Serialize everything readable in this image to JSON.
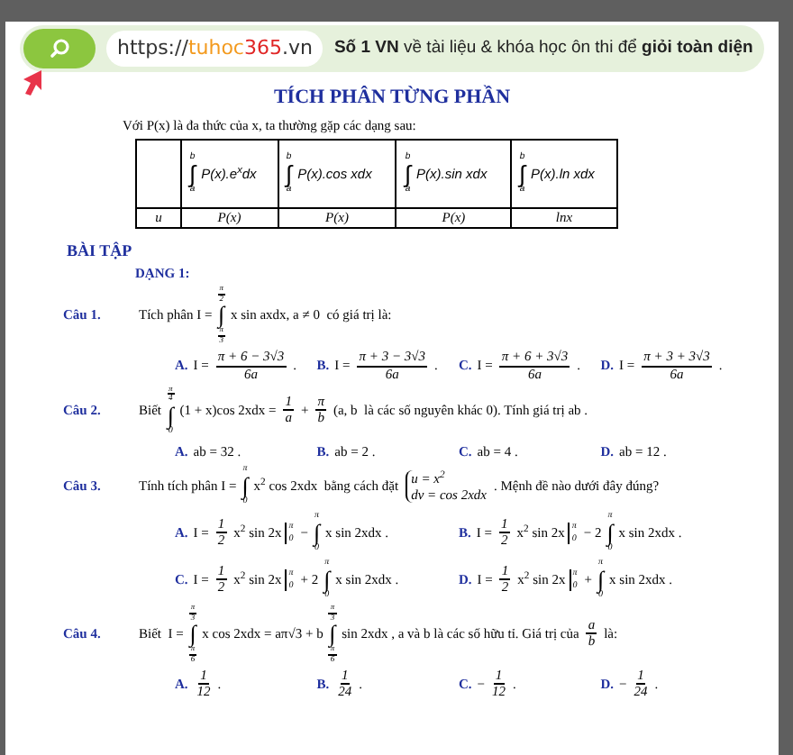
{
  "banner": {
    "url_parts": [
      {
        "text": "https://",
        "color": "#333333"
      },
      {
        "text": "tuhoc",
        "color": "#f39a1e"
      },
      {
        "text": "365",
        "color": "#e02626"
      },
      {
        "text": ".vn",
        "color": "#333333"
      }
    ],
    "tagline": "**Số 1 VN** về tài liệu & khóa học ôn thi để **giỏi toàn diện**"
  },
  "title": "TÍCH PHÂN TỪNG PHẦN",
  "intro": "Với P(x) là đa thức của x, ta thường gặp các dạng sau:",
  "table": {
    "header": [
      [
        {
          "kind": "int",
          "sign": "∫",
          "upper": "b",
          "lower": "a"
        },
        {
          "kind": "text",
          "text": "P(x).e$^{x}$dx"
        }
      ],
      [
        {
          "kind": "int",
          "sign": "∫",
          "upper": "b",
          "lower": "a"
        },
        {
          "kind": "text",
          "text": "P(x).cos xdx"
        }
      ],
      [
        {
          "kind": "int",
          "sign": "∫",
          "upper": "b",
          "lower": "a"
        },
        {
          "kind": "text",
          "text": "P(x).sin xdx"
        }
      ],
      [
        {
          "kind": "int",
          "sign": "∫",
          "upper": "b",
          "lower": "a"
        },
        {
          "kind": "text",
          "text": "P(x).ln xdx"
        }
      ]
    ],
    "row": [
      "u",
      "P(x)",
      "P(x)",
      "P(x)",
      "lnx"
    ]
  },
  "section": "BÀI TẬP",
  "subsection": "DẠNG 1:",
  "questions": [
    {
      "label": "Câu 1.",
      "stem": [
        {
          "kind": "text",
          "text": "Tích phân I ="
        },
        {
          "kind": "int",
          "sign": "∫",
          "upper": {
            "num": "π",
            "den": "2"
          },
          "lower": {
            "num": "π",
            "den": "3"
          }
        },
        {
          "kind": "text",
          "text": "x sin axdx, a ≠ 0  có giá trị là:"
        }
      ],
      "option_rows": [
        [
          {
            "label": "A.",
            "parts": [
              {
                "kind": "text",
                "text": "I ="
              },
              {
                "kind": "frac",
                "num": "π + 6 − 3√3",
                "den": "6a"
              },
              {
                "kind": "text",
                "text": "."
              }
            ]
          },
          {
            "label": "B.",
            "parts": [
              {
                "kind": "text",
                "text": "I ="
              },
              {
                "kind": "frac",
                "num": "π + 3 − 3√3",
                "den": "6a"
              },
              {
                "kind": "text",
                "text": "."
              }
            ]
          },
          {
            "label": "C.",
            "parts": [
              {
                "kind": "text",
                "text": "I ="
              },
              {
                "kind": "frac",
                "num": "π + 6 + 3√3",
                "den": "6a"
              },
              {
                "kind": "text",
                "text": "."
              }
            ]
          },
          {
            "label": "D.",
            "parts": [
              {
                "kind": "text",
                "text": "I ="
              },
              {
                "kind": "frac",
                "num": "π + 3 + 3√3",
                "den": "6a"
              },
              {
                "kind": "text",
                "text": "."
              }
            ]
          }
        ]
      ]
    },
    {
      "label": "Câu 2.",
      "stem": [
        {
          "kind": "text",
          "text": "Biết"
        },
        {
          "kind": "int",
          "sign": "∫",
          "upper": {
            "num": "π",
            "den": "4"
          },
          "lower": "0"
        },
        {
          "kind": "text",
          "text": "(1 + x)cos 2xdx ="
        },
        {
          "kind": "frac",
          "num": "1",
          "den": "a"
        },
        {
          "kind": "text",
          "text": "+"
        },
        {
          "kind": "frac",
          "num": "π",
          "den": "b"
        },
        {
          "kind": "text",
          "text": "(a, b  là các số nguyên khác 0). Tính giá trị ab ."
        }
      ],
      "option_rows": [
        [
          {
            "label": "A.",
            "parts": [
              {
                "kind": "text",
                "text": "ab = 32 ."
              }
            ]
          },
          {
            "label": "B.",
            "parts": [
              {
                "kind": "text",
                "text": "ab = 2 ."
              }
            ]
          },
          {
            "label": "C.",
            "parts": [
              {
                "kind": "text",
                "text": "ab = 4 ."
              }
            ]
          },
          {
            "label": "D.",
            "parts": [
              {
                "kind": "text",
                "text": "ab = 12 ."
              }
            ]
          }
        ]
      ]
    },
    {
      "label": "Câu 3.",
      "stem": [
        {
          "kind": "text",
          "text": "Tính tích phân I ="
        },
        {
          "kind": "int",
          "sign": "∫",
          "upper": "π",
          "lower": "0"
        },
        {
          "kind": "text",
          "text": "x$^{2}$ cos 2xdx  bằng cách đặt"
        },
        {
          "kind": "system",
          "lines": [
            "u = x$^{2}$",
            "dv = cos 2xdx"
          ]
        },
        {
          "kind": "text",
          "text": ". Mệnh đề nào dưới đây đúng?"
        }
      ],
      "option_rows": [
        [
          {
            "label": "A.",
            "parts": [
              {
                "kind": "text",
                "text": "I ="
              },
              {
                "kind": "frac",
                "num": "1",
                "den": "2"
              },
              {
                "kind": "text",
                "text": "x$^{2}$ sin 2x"
              },
              {
                "kind": "eval",
                "upper": "π",
                "lower": "0"
              },
              {
                "kind": "text",
                "text": "−"
              },
              {
                "kind": "int",
                "sign": "∫",
                "upper": "π",
                "lower": "0"
              },
              {
                "kind": "text",
                "text": "x sin 2xdx ."
              }
            ]
          },
          {
            "label": "B.",
            "parts": [
              {
                "kind": "text",
                "text": "I ="
              },
              {
                "kind": "frac",
                "num": "1",
                "den": "2"
              },
              {
                "kind": "text",
                "text": "x$^{2}$ sin 2x"
              },
              {
                "kind": "eval",
                "upper": "π",
                "lower": "0"
              },
              {
                "kind": "text",
                "text": "− 2"
              },
              {
                "kind": "int",
                "sign": "∫",
                "upper": "π",
                "lower": "0"
              },
              {
                "kind": "text",
                "text": "x sin 2xdx ."
              }
            ]
          }
        ],
        [
          {
            "label": "C.",
            "parts": [
              {
                "kind": "text",
                "text": "I ="
              },
              {
                "kind": "frac",
                "num": "1",
                "den": "2"
              },
              {
                "kind": "text",
                "text": "x$^{2}$ sin 2x"
              },
              {
                "kind": "eval",
                "upper": "π",
                "lower": "0"
              },
              {
                "kind": "text",
                "text": "+ 2"
              },
              {
                "kind": "int",
                "sign": "∫",
                "upper": "π",
                "lower": "0"
              },
              {
                "kind": "text",
                "text": "x sin 2xdx ."
              }
            ]
          },
          {
            "label": "D.",
            "parts": [
              {
                "kind": "text",
                "text": "I ="
              },
              {
                "kind": "frac",
                "num": "1",
                "den": "2"
              },
              {
                "kind": "text",
                "text": "x$^{2}$ sin 2x"
              },
              {
                "kind": "eval",
                "upper": "π",
                "lower": "0"
              },
              {
                "kind": "text",
                "text": "+"
              },
              {
                "kind": "int",
                "sign": "∫",
                "upper": "π",
                "lower": "0"
              },
              {
                "kind": "text",
                "text": "x sin 2xdx ."
              }
            ]
          }
        ]
      ]
    },
    {
      "label": "Câu 4.",
      "stem": [
        {
          "kind": "text",
          "text": "Biết  I ="
        },
        {
          "kind": "int",
          "sign": "∫",
          "upper": {
            "num": "π",
            "den": "3"
          },
          "lower": {
            "num": "π",
            "den": "6"
          }
        },
        {
          "kind": "text",
          "text": "x cos 2xdx = aπ√3 + b"
        },
        {
          "kind": "int",
          "sign": "∫",
          "upper": {
            "num": "π",
            "den": "3"
          },
          "lower": {
            "num": "π",
            "den": "6"
          }
        },
        {
          "kind": "text",
          "text": "sin 2xdx , a và b là các số hữu tỉ. Giá trị của"
        },
        {
          "kind": "frac",
          "num": "a",
          "den": "b"
        },
        {
          "kind": "text",
          "text": "là:"
        }
      ],
      "option_rows": [
        [
          {
            "label": "A.",
            "parts": [
              {
                "kind": "frac",
                "num": "1",
                "den": "12"
              },
              {
                "kind": "text",
                "text": "."
              }
            ]
          },
          {
            "label": "B.",
            "parts": [
              {
                "kind": "frac",
                "num": "1",
                "den": "24"
              },
              {
                "kind": "text",
                "text": "."
              }
            ]
          },
          {
            "label": "C.",
            "parts": [
              {
                "kind": "text",
                "text": "−"
              },
              {
                "kind": "frac",
                "num": "1",
                "den": "12"
              },
              {
                "kind": "text",
                "text": "."
              }
            ]
          },
          {
            "label": "D.",
            "parts": [
              {
                "kind": "text",
                "text": "−"
              },
              {
                "kind": "frac",
                "num": "1",
                "den": "24"
              },
              {
                "kind": "text",
                "text": "."
              }
            ]
          }
        ]
      ]
    }
  ]
}
